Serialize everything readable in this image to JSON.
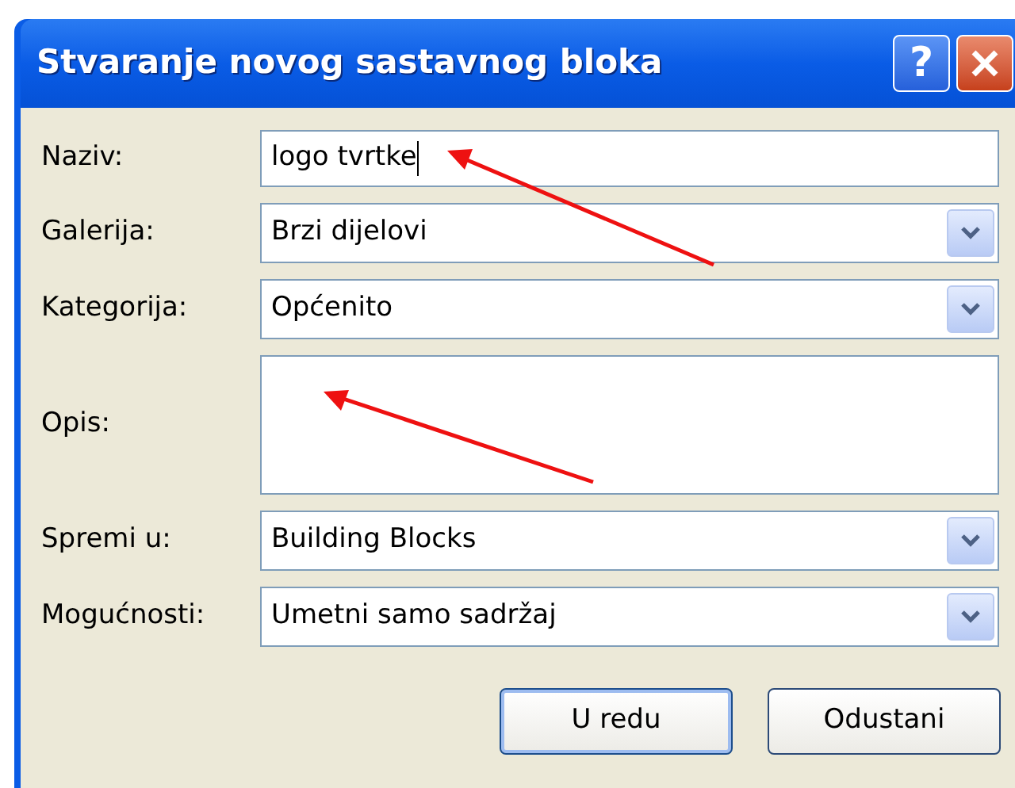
{
  "window": {
    "title": "Stvaranje novog sastavnog bloka",
    "help_button": "?"
  },
  "fields": [
    {
      "label": "Naziv:",
      "kind": "text",
      "value": "logo tvrtke",
      "focused": true,
      "pointed_at": true
    },
    {
      "label": "Galerija:",
      "kind": "combo",
      "value": "Brzi dijelovi",
      "focused": false,
      "pointed_at": false
    },
    {
      "label": "Kategorija:",
      "kind": "combo",
      "value": "Općenito",
      "focused": false,
      "pointed_at": false
    },
    {
      "label": "Opis:",
      "kind": "textarea",
      "focused": false,
      "pointed_at": true
    },
    {
      "label": "Spremi u:",
      "kind": "combo",
      "value": "Building Blocks",
      "focused": false,
      "pointed_at": false
    },
    {
      "label": "Mogućnosti:",
      "kind": "combo",
      "value": "Umetni samo sadržaj",
      "focused": false,
      "pointed_at": false
    }
  ],
  "buttons": [
    {
      "label": "U redu",
      "default": true
    },
    {
      "label": "Odustani",
      "default": false
    }
  ]
}
